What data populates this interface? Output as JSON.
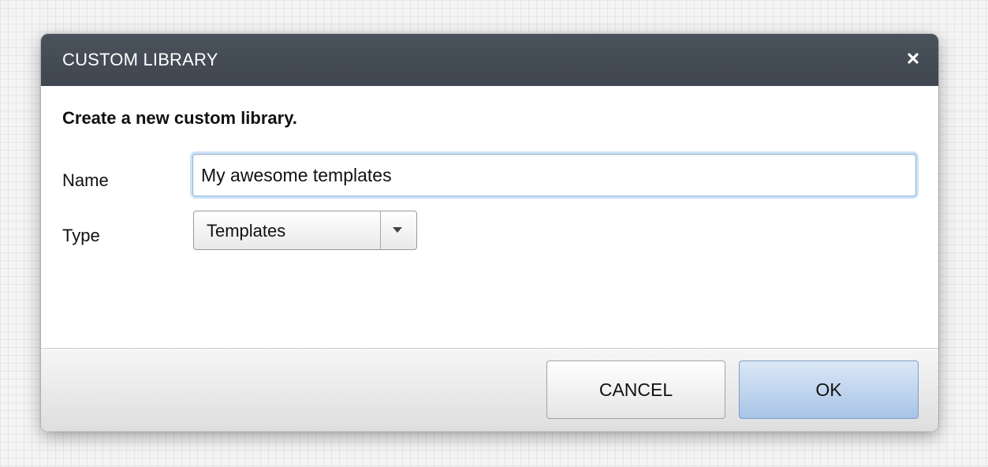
{
  "dialog": {
    "title": "CUSTOM LIBRARY",
    "close_icon": "close-icon",
    "heading": "Create a new custom library.",
    "name_label": "Name",
    "name_value": "My awesome templates",
    "type_label": "Type",
    "type_value": "Templates",
    "cancel_label": "CANCEL",
    "ok_label": "OK"
  },
  "colors": {
    "titlebar": "#434a54",
    "focus_ring": "#cfe2f6",
    "ok_button": "#a8c4e6"
  }
}
